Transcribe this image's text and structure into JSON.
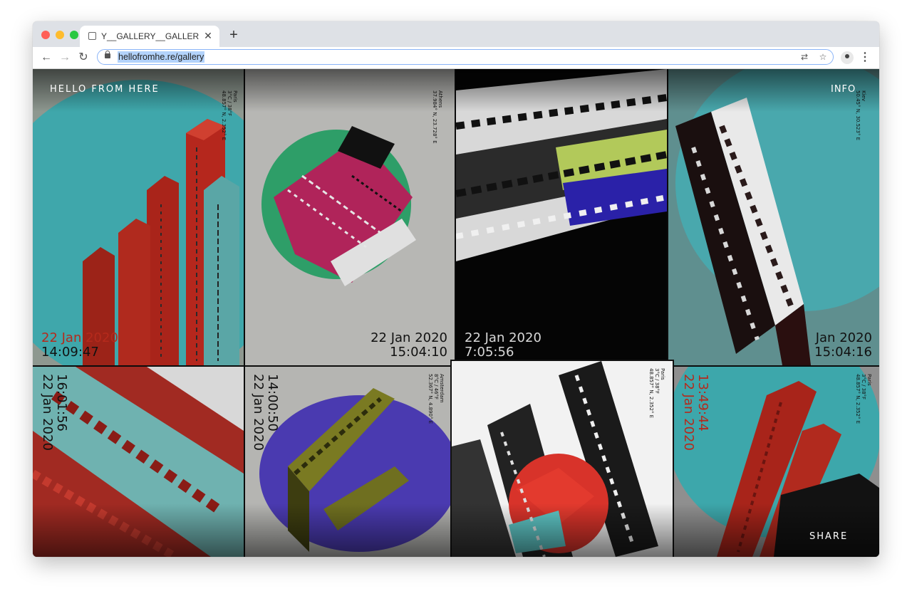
{
  "browser": {
    "tab_title": "Y__GALLERY__GALLER",
    "url": "hellofromhe.re/gallery",
    "colors": {
      "close": "#ff5f57",
      "minimize": "#febc2e",
      "zoom": "#28c840"
    }
  },
  "site": {
    "logo": "HELLO FROM HERE",
    "info": "INFO",
    "share": "SHARE"
  },
  "tiles": [
    {
      "date": "22 Jan 2020",
      "time": "14:09:47",
      "city": "Paris",
      "temp": "3°C / 38°F",
      "coords": "48.857° N, 2.352° E"
    },
    {
      "date": "22 Jan 2020",
      "time": "15:04:10",
      "city": "Athens",
      "temp": "",
      "coords": "37.984° N, 23.728° E"
    },
    {
      "date": "22 Jan 2020",
      "time": "7:05:56",
      "city": "",
      "temp": "",
      "coords": ""
    },
    {
      "date": "Jan 2020",
      "time": "15:04:16",
      "city": "Kiev",
      "temp": "",
      "coords": "50.45° N, 30.523° E"
    },
    {
      "date": "22 Jan 2020",
      "time": "16:01:56",
      "city": "",
      "temp": "",
      "coords": ""
    },
    {
      "date": "22 Jan 2020",
      "time": "14:00:50",
      "city": "Amsterdam",
      "temp": "8°C / 46°F",
      "coords": "52.367° N, 4.890° E"
    },
    {
      "date": "",
      "time": "",
      "city": "Paris",
      "temp": "3°C / 38°F",
      "coords": "48.857° N, 2.352° E"
    },
    {
      "date": "22 Jan 2020",
      "time": "13:49:44",
      "city": "Paris",
      "temp": "3°C / 38°F",
      "coords": "48.857° N, 2.352° E"
    }
  ]
}
